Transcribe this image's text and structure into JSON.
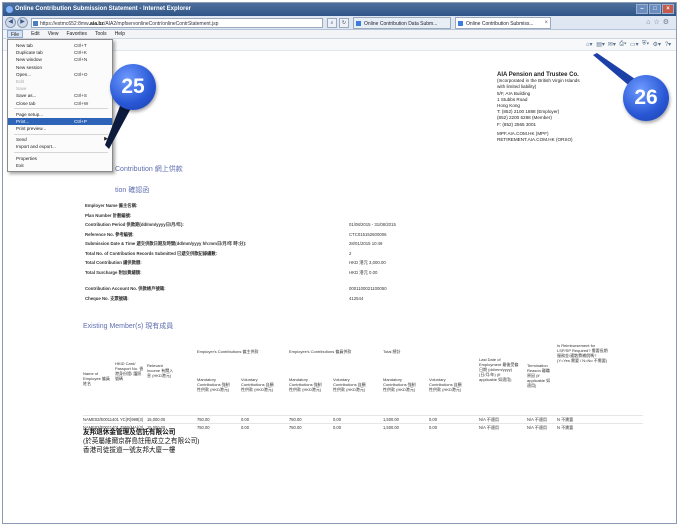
{
  "window": {
    "title": "Online Contribution Submission Statement - Internet Explorer"
  },
  "address": {
    "url_prefix": "https://estmc652:8mw",
    "host": ".aia.bz",
    "url_suffix": "/AIA2/mpfservonlineContr/onlineContrStatement.jsp",
    "tabs": [
      {
        "label": "Online Contribution Data Subm..."
      },
      {
        "label": "Online Contribution Submiss..."
      }
    ]
  },
  "menubar": {
    "items": [
      "File",
      "Edit",
      "View",
      "Favorites",
      "Tools",
      "Help"
    ]
  },
  "file_menu": {
    "items": [
      {
        "label": "New tab",
        "shortcut": "Ctrl+T"
      },
      {
        "label": "Duplicate tab",
        "shortcut": "Ctrl+K"
      },
      {
        "label": "New window",
        "shortcut": "Ctrl+N"
      },
      {
        "label": "New session",
        "shortcut": ""
      },
      {
        "label": "Open...",
        "shortcut": "Ctrl+O"
      },
      {
        "label": "Edit",
        "shortcut": ""
      },
      {
        "label": "Save",
        "shortcut": ""
      },
      {
        "label": "Save as...",
        "shortcut": "Ctrl+S"
      },
      {
        "label": "Close tab",
        "shortcut": "Ctrl+W"
      },
      {
        "label": "Page setup...",
        "shortcut": ""
      },
      {
        "label": "Print...",
        "shortcut": "Ctrl+P"
      },
      {
        "label": "Print preview...",
        "shortcut": ""
      },
      {
        "label": "Send",
        "shortcut": ""
      },
      {
        "label": "Import and export...",
        "shortcut": ""
      },
      {
        "label": "Properties",
        "shortcut": ""
      },
      {
        "label": "Exit",
        "shortcut": ""
      }
    ]
  },
  "callouts": {
    "left": "25",
    "right": "26"
  },
  "company": {
    "name": "AIA Pension and Trustee Co.",
    "lines": [
      "(Incorporated in the British Virgin Islands",
      "with limited liability)",
      "5/F, AIA Building",
      "1 Stubbs Road",
      "Hong Kong",
      "T: (852) 2100 1888 (Employer)",
      "    (852) 2200 6288 (Member)",
      "F: (852) 2565 3001",
      "MPF.AIA.COM.HK (MPF)",
      "RETIREMENT.AIA.COM.HK (ORSO)"
    ]
  },
  "headings": {
    "main": "Contribution 網上供款",
    "sub": "tion 確認函",
    "members": "Existing Member(s) 現有成員"
  },
  "info": {
    "rows1": [
      {
        "label": "Employer Name 僱主名稱:",
        "value": ""
      },
      {
        "label": "Plan Number 計劃編號:",
        "value": ""
      },
      {
        "label": "Contribution Period 供款期(dd/mm/yyyy日/月/年):",
        "value": "01/08/2015 - 31/08/2015"
      },
      {
        "label": "Reference No. 參考編號:",
        "value": "CTC015152600006"
      },
      {
        "label": "Submission Date & Time 遞交供款日期及時間(dd/mm/yyyy hh:mm日/月/年 時:分):",
        "value": "28/01/2015 10:49"
      },
      {
        "label": "Total No. of Contribution Records Submitted 已遞交供款記錄總數:",
        "value": "2"
      },
      {
        "label": "Total Contribution 總供款額:",
        "value": "HKD 港元 3,000.00"
      },
      {
        "label": "Total Surcharge 附加費總額:",
        "value": "HKD 港元 0.00"
      }
    ],
    "rows2": [
      {
        "label": "Contribution Account No. 供款帳戶號碼:",
        "value": "0001100021100050"
      },
      {
        "label": "Cheque No. 支票號碼:",
        "value": "412544"
      }
    ]
  },
  "members_table": {
    "headers": {
      "name": "Name of Employee 僱員姓名",
      "hkid": "HKID Card/ Passport No. 香港身份證/ 護照號碼",
      "income": "Relevant Income 有關入息 (HKD港元)",
      "er_group": "Employer's Contributions 僱主供款",
      "ee_group": "Employee's Contributions 僱員供款",
      "total_group": "Total 總計",
      "mandatory": "Mandatory Contributions 強制性供款 (HKD港元)",
      "voluntary": "Voluntary Contributions 自願性供款 (HKD港元)",
      "last_date": "Last Date of Employment 最後受僱日期 (dd/mm/yyyy) (日/月/年) (if applicable 如適用)",
      "termination": "Termination Reason 離職原因 (if applicable 如適用)",
      "reimburse": "Is Reimbursement for LSP/SP Required? 需要長期服務金/遣散費補償嗎? (Y=Yes 需要 / N=No 不需要)"
    },
    "rows": [
      {
        "name_id": "NAME02/E0011401 YC(R)999(3)",
        "income": "15,000.00",
        "er_m": "750.00",
        "er_v": "0.00",
        "ee_m": "750.00",
        "ee_v": "0.00",
        "t_m": "1,500.00",
        "t_v": "0.00",
        "last": "N/A 不適用",
        "term": "N/A 不適用",
        "reimb": "N 不需要"
      },
      {
        "name_id": "NAME02/E0011401 Z955(MA)(3)",
        "income": "15,000.00",
        "er_m": "750.00",
        "er_v": "0.00",
        "ee_m": "750.00",
        "ee_v": "0.00",
        "t_m": "1,500.00",
        "t_v": "0.00",
        "last": "N/A 不適用",
        "term": "N/A 不適用",
        "reimb": "N 不需要"
      }
    ],
    "footer_cn": [
      "友邦退休金管理及信託有限公司",
      "(於英屬維爾京群島註冊成立之有限公司)",
      "香港司徒拔道一號友邦大廈一樓"
    ]
  }
}
